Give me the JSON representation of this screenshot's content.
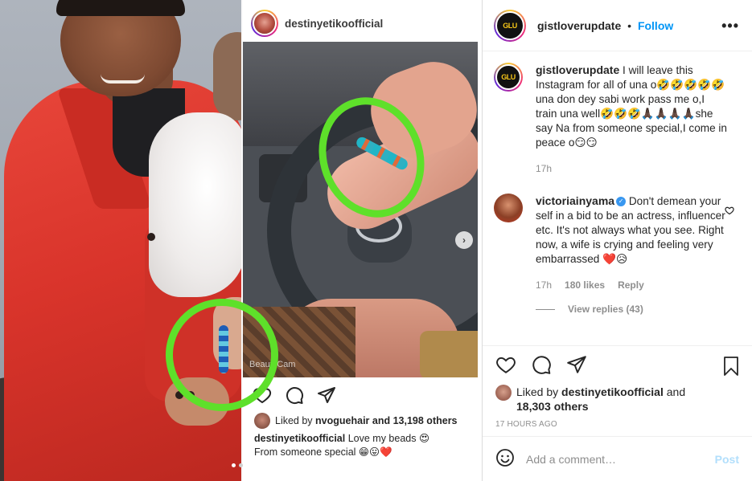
{
  "media": {
    "embedded_post": {
      "username": "destinyetikoofficial",
      "watermark": "BeautyCam",
      "liked_by_prefix": "Liked by",
      "liked_by_user": "nvoguehair",
      "liked_by_suffix": "and 13,198 others",
      "caption_user": "destinyetikoofficial",
      "caption_line1": "Love my beads 😍",
      "caption_line2": "From someone special 😁😛❤️"
    },
    "highlight_color": "#5ee02a"
  },
  "header": {
    "username": "gistloverupdate",
    "separator": "•",
    "follow_label": "Follow",
    "more_label": "•••",
    "avatar_text": "GLU"
  },
  "caption": {
    "username": "gistloverupdate",
    "text": "I will leave this Instagram for all of una o🤣🤣🤣🤣🤣una don dey sabi work pass me o,I train una well🤣🤣🤣🙏🏿🙏🏿🙏🏿🙏🏿she say Na from someone special,I come in peace o😏😏",
    "time": "17h"
  },
  "comments": [
    {
      "username": "victoriainyama",
      "verified": true,
      "text": "Don't demean your self in a bid to be an actress, influencer etc. It's not always what you see. Right now, a wife is crying and feeling very embarrassed ❤️😥",
      "time": "17h",
      "likes": "180 likes",
      "reply_label": "Reply",
      "view_replies": "View replies (43)"
    }
  ],
  "actions": {
    "like_icon": "heart-outline-icon",
    "comment_icon": "comment-icon",
    "share_icon": "paper-plane-icon",
    "save_icon": "bookmark-icon"
  },
  "likes": {
    "prefix": "Liked by",
    "user": "destinyetikoofficial",
    "and": "and",
    "count": "18,303 others"
  },
  "timestamp": "17 HOURS AGO",
  "comment_box": {
    "placeholder": "Add a comment…",
    "post_label": "Post",
    "emoji_icon": "smiley-icon"
  },
  "colors": {
    "link_blue": "#0095f6",
    "post_disabled": "#b2dffc",
    "muted": "#8e8e8e",
    "border": "#efefef"
  }
}
